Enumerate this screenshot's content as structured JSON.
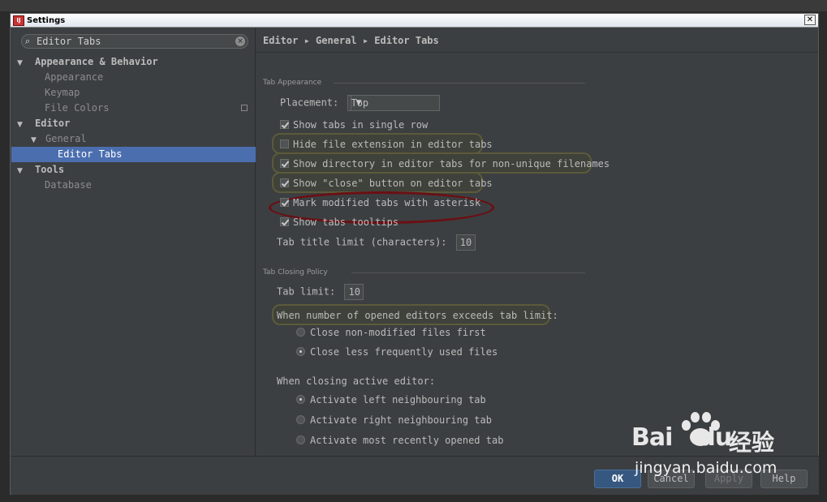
{
  "window": {
    "title": "Settings",
    "close_glyph": "✕",
    "app_icon_label": "IJ"
  },
  "search": {
    "value": "Editor Tabs",
    "search_glyph": "🔍",
    "clear_glyph": "×"
  },
  "sidebar": {
    "items": [
      {
        "label": "Appearance & Behavior",
        "arrow": "▼"
      },
      {
        "label": "Appearance"
      },
      {
        "label": "Keymap"
      },
      {
        "label": "File Colors"
      },
      {
        "label": "Editor",
        "arrow": "▼"
      },
      {
        "label": "General",
        "arrow": "▼"
      },
      {
        "label": "Editor Tabs"
      },
      {
        "label": "Tools",
        "arrow": "▼"
      },
      {
        "label": "Database"
      }
    ]
  },
  "breadcrumb": "Editor ▸ General ▸ Editor Tabs",
  "tab_appearance": {
    "title": "Tab Appearance",
    "placement_label": "Placement:",
    "placement_value": "Top",
    "placement_dd": "▼",
    "options": [
      {
        "label": "Show tabs in single row",
        "checked": true
      },
      {
        "label": "Hide file extension in editor tabs",
        "checked": false
      },
      {
        "label": "Show directory in editor tabs for non-unique filenames",
        "checked": true
      },
      {
        "label": "Show \"close\" button on editor tabs",
        "checked": true
      },
      {
        "label": "Mark modified tabs with asterisk",
        "checked": true
      },
      {
        "label": "Show tabs tooltips",
        "checked": true
      }
    ],
    "title_limit_label": "Tab title limit (characters):",
    "title_limit_value": "10"
  },
  "tab_closing": {
    "title": "Tab Closing Policy",
    "tab_limit_label": "Tab limit:",
    "tab_limit_value": "10",
    "exceed_label": "When number of opened editors exceeds tab limit:",
    "exceed_options": [
      {
        "label": "Close non-modified files first",
        "selected": false
      },
      {
        "label": "Close less frequently used files",
        "selected": true
      }
    ],
    "closing_label": "When closing active editor:",
    "closing_options": [
      {
        "label": "Activate left neighbouring tab",
        "selected": true
      },
      {
        "label": "Activate right neighbouring tab",
        "selected": false
      },
      {
        "label": "Activate most recently opened tab",
        "selected": false
      }
    ]
  },
  "buttons": {
    "ok": "OK",
    "cancel": "Cancel",
    "apply": "Apply",
    "help": "Help"
  },
  "watermark": {
    "logo": "Bai",
    "logo2": "du",
    "cn": "经验",
    "url": "jingyan.baidu.com"
  },
  "colors": {
    "accent": "#4b6eaf",
    "primary_button": "#365880",
    "highlight_ring": "#5c5a3a",
    "annotation_red": "#6a0f14"
  }
}
